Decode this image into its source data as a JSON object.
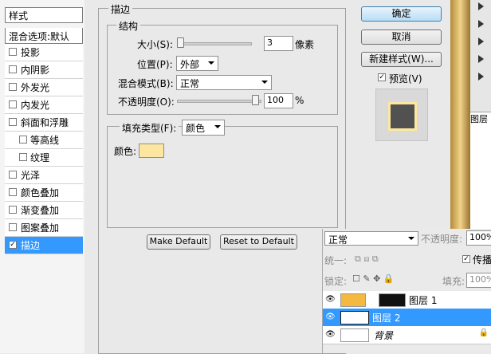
{
  "styles_panel": {
    "header": "样式",
    "blend_default": "混合选项:默认",
    "items": [
      {
        "label": "投影",
        "checked": false
      },
      {
        "label": "内阴影",
        "checked": false
      },
      {
        "label": "外发光",
        "checked": false
      },
      {
        "label": "内发光",
        "checked": false
      },
      {
        "label": "斜面和浮雕",
        "checked": false
      },
      {
        "label": "等高线",
        "checked": false
      },
      {
        "label": "纹理",
        "checked": false
      },
      {
        "label": "光泽",
        "checked": false
      },
      {
        "label": "颜色叠加",
        "checked": false
      },
      {
        "label": "渐变叠加",
        "checked": false
      },
      {
        "label": "图案叠加",
        "checked": false
      },
      {
        "label": "描边",
        "checked": true
      }
    ],
    "check_mark": "✓"
  },
  "stroke": {
    "section_title": "描边",
    "structure_title": "结构",
    "size_label": "大小(S):",
    "size_value": "3",
    "size_unit": "像素",
    "position_label": "位置(P):",
    "position_value": "外部",
    "blend_label": "混合模式(B):",
    "blend_value": "正常",
    "opacity_label": "不透明度(O):",
    "opacity_value": "100",
    "opacity_unit": "%",
    "fill_type_label": "填充类型(F):",
    "fill_type_value": "颜色",
    "color_label": "颜色:",
    "stroke_color": "#fde7a0",
    "make_default": "Make Default",
    "reset_default": "Reset to Default"
  },
  "actions": {
    "ok": "确定",
    "cancel": "取消",
    "new_style": "新建样式(W)...",
    "preview_label": "预览(V)",
    "preview_checked": true
  },
  "layers": {
    "blend_mode": "正常",
    "opacity_label": "不透明度:",
    "opacity_value": "100%",
    "unify_label": "统一:",
    "propagate_label": "传播",
    "lock_label": "锁定:",
    "fill_label": "填充:",
    "fill_value": "100%",
    "rows": [
      {
        "name": "图层 1",
        "selected": false
      },
      {
        "name": "图层 2",
        "selected": true
      },
      {
        "name": "背景",
        "selected": false
      }
    ]
  },
  "right_panel": {
    "layers_title": "图层"
  }
}
